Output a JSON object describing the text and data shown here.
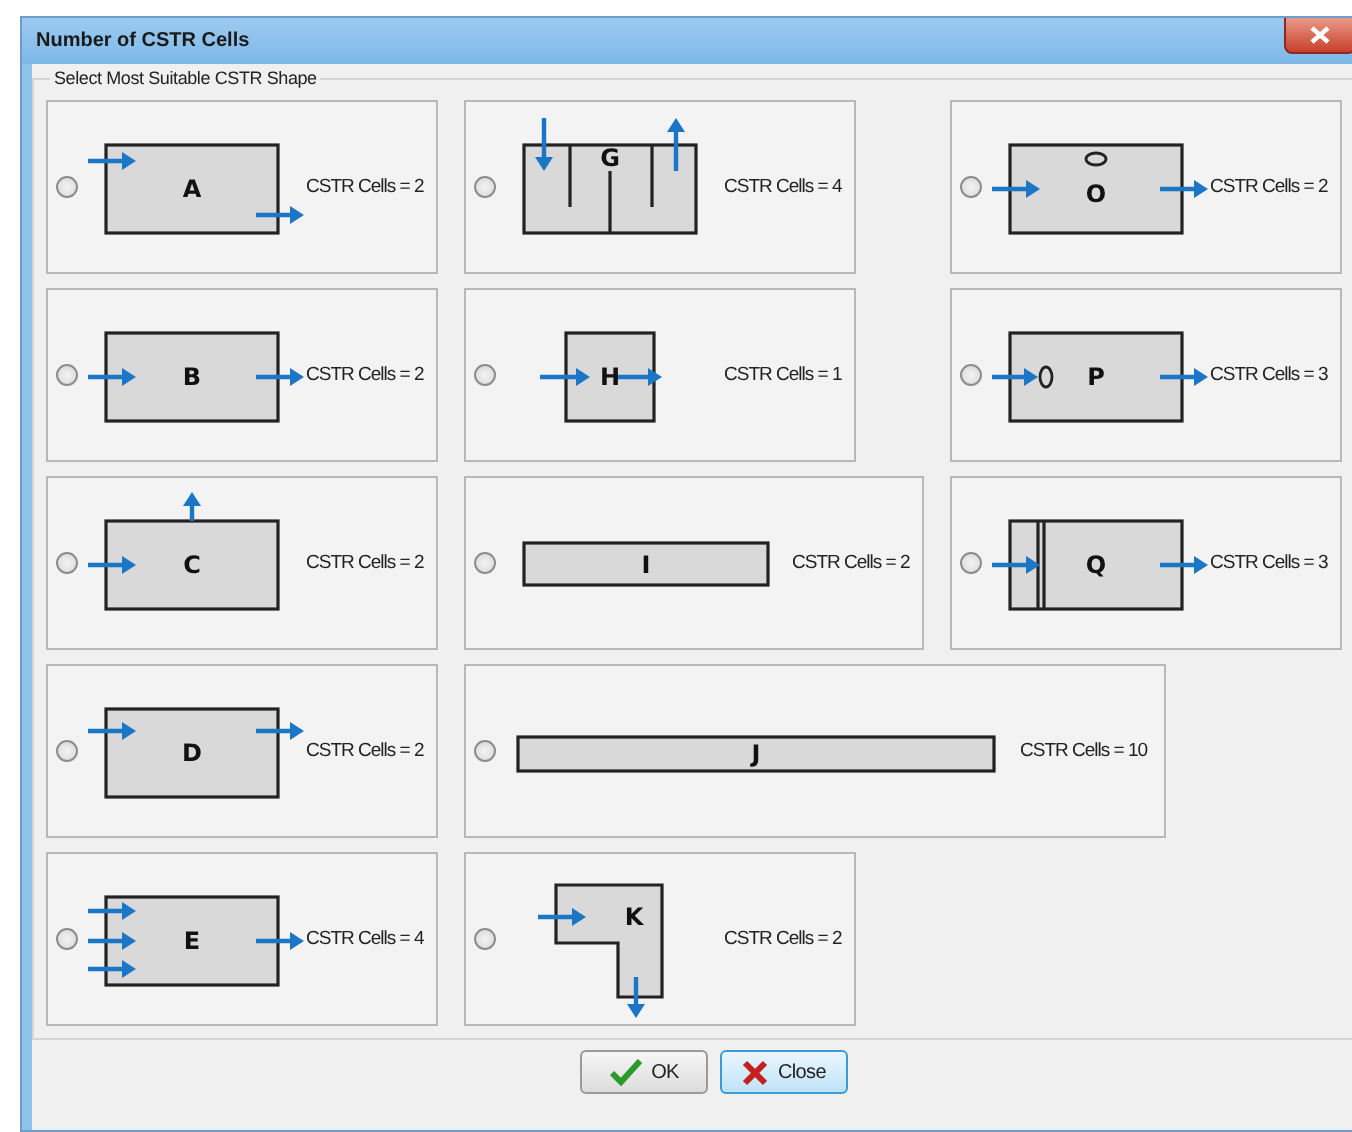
{
  "window": {
    "title": "Number of CSTR Cells"
  },
  "group": {
    "label": "Select Most Suitable CSTR Shape"
  },
  "rows": [
    [
      {
        "letter": "A",
        "kind": "offset",
        "cells": "CSTR Cells = 2",
        "selected": false
      },
      {
        "letter": "G",
        "kind": "baffled",
        "cells": "CSTR Cells = 4",
        "selected": false
      },
      {
        "letter": "O",
        "kind": "top-port",
        "cells": "CSTR Cells = 2",
        "selected": false
      }
    ],
    [
      {
        "letter": "B",
        "kind": "straight",
        "cells": "CSTR Cells = 2",
        "selected": false
      },
      {
        "letter": "H",
        "kind": "square",
        "cells": "CSTR Cells = 1",
        "selected": false
      },
      {
        "letter": "P",
        "kind": "side-port",
        "cells": "CSTR Cells = 3",
        "selected": false
      }
    ],
    [
      {
        "letter": "C",
        "kind": "top-out",
        "cells": "CSTR Cells = 2",
        "selected": false
      },
      {
        "letter": "I",
        "kind": "bar",
        "cells": "CSTR Cells = 2",
        "selected": false
      },
      {
        "letter": "Q",
        "kind": "partition",
        "cells": "CSTR Cells = 3",
        "selected": false
      }
    ],
    [
      {
        "letter": "D",
        "kind": "top-in",
        "cells": "CSTR Cells = 2",
        "selected": false
      },
      {
        "letter": "J",
        "kind": "long-bar",
        "cells": "CSTR Cells = 10",
        "selected": false
      }
    ],
    [
      {
        "letter": "E",
        "kind": "triple-in",
        "cells": "CSTR Cells = 4",
        "selected": false
      },
      {
        "letter": "K",
        "kind": "l-shape",
        "cells": "CSTR Cells = 2",
        "selected": false
      }
    ]
  ],
  "buttons": [
    {
      "label": "OK",
      "kind": "ok",
      "focused": false
    },
    {
      "label": "Close",
      "kind": "close",
      "focused": true
    }
  ]
}
